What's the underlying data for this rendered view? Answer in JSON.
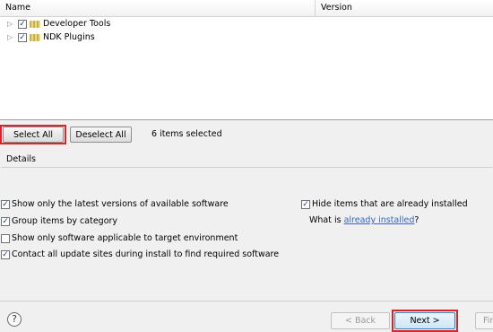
{
  "table": {
    "col_name": "Name",
    "col_version": "Version",
    "rows": [
      {
        "label": "Developer Tools",
        "checked": true
      },
      {
        "label": "NDK Plugins",
        "checked": true
      }
    ]
  },
  "buttons": {
    "select_all": "Select All",
    "deselect_all": "Deselect All",
    "selected_count": "6 items selected"
  },
  "details": {
    "label": "Details"
  },
  "options": {
    "latest": "Show only the latest versions of available software",
    "group": "Group items by category",
    "target_env": "Show only software applicable to target environment",
    "contact": "Contact all update sites during install to find required software",
    "hide_installed": "Hide items that are already installed",
    "what_is_prefix": "What is ",
    "what_is_link": "already installed",
    "what_is_suffix": "?"
  },
  "nav": {
    "help": "?",
    "back": "< Back",
    "next": "Next >",
    "finish": "Fin"
  },
  "colors": {
    "highlight": "#d9252a",
    "link": "#2f66c9"
  }
}
